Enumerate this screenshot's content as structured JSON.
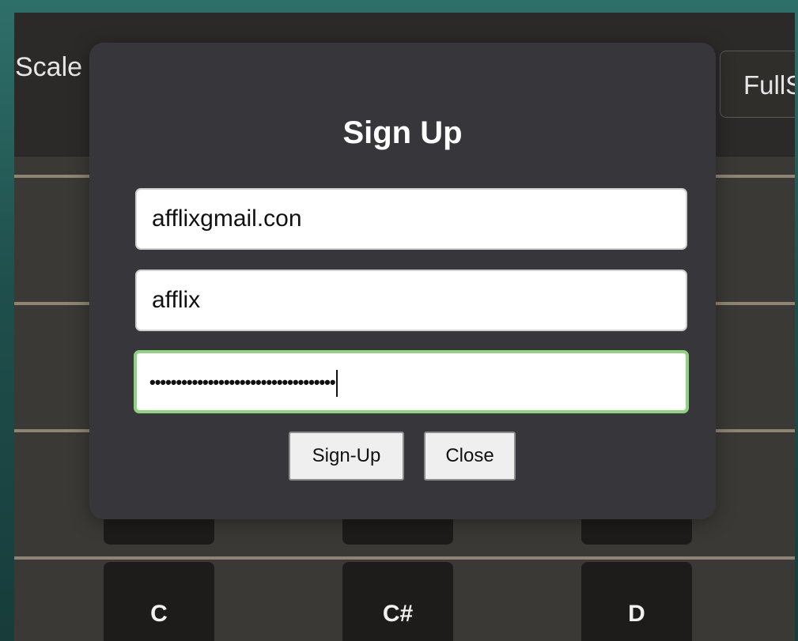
{
  "background_app": {
    "scale_label": "Scale",
    "fullscreen_label": "FullS",
    "keys": [
      "C",
      "C#",
      "D"
    ]
  },
  "modal": {
    "title": "Sign Up",
    "email_value": "afflixgmail.con",
    "username_value": "afflix",
    "password_masked": "•••••••••••••••••••••••••••••••••••",
    "signup_label": "Sign-Up",
    "close_label": "Close"
  },
  "colors": {
    "modal_bg": "#37363b",
    "focus_border": "#8fd27f",
    "fret_line": "#8e8474",
    "key_bg": "#1d1c1a"
  }
}
